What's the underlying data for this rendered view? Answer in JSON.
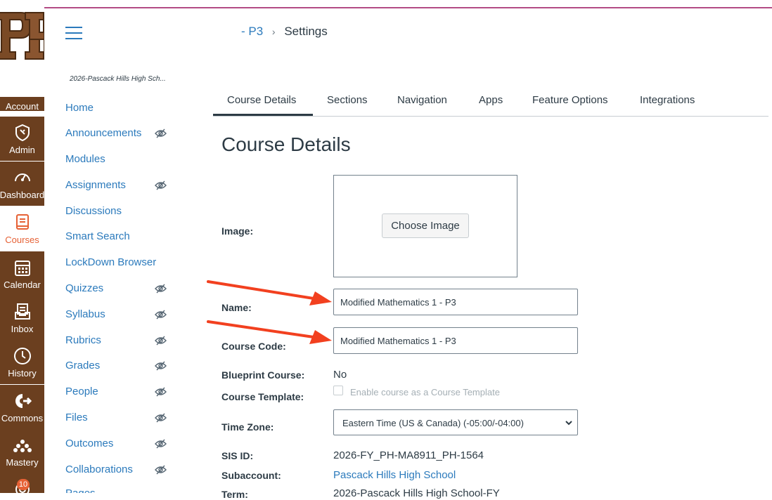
{
  "colors": {
    "nav_bg": "#6b3f1f",
    "accent": "#e66135",
    "link": "#2b7abc",
    "annotation_arrow": "#f2401f"
  },
  "global_nav": {
    "items": [
      {
        "label": "Account",
        "icon": "account-icon"
      },
      {
        "label": "Admin",
        "icon": "admin-shield-icon"
      },
      {
        "label": "Dashboard",
        "icon": "dashboard-gauge-icon"
      },
      {
        "label": "Courses",
        "icon": "courses-book-icon",
        "active": true
      },
      {
        "label": "Calendar",
        "icon": "calendar-icon"
      },
      {
        "label": "Inbox",
        "icon": "inbox-icon"
      },
      {
        "label": "History",
        "icon": "history-clock-icon"
      },
      {
        "label": "Commons",
        "icon": "commons-icon"
      },
      {
        "label": "Mastery",
        "icon": "mastery-dots-icon"
      },
      {
        "label": "",
        "icon": "help-icon",
        "badge": "10"
      }
    ]
  },
  "header": {
    "breadcrumb_course": "- P3",
    "breadcrumb_separator": "›",
    "breadcrumb_current": "Settings"
  },
  "course_nav": {
    "course_name": "2026-Pascack Hills High Sch...",
    "items": [
      {
        "label": "Home",
        "hidden": false
      },
      {
        "label": "Announcements",
        "hidden": true
      },
      {
        "label": "Modules",
        "hidden": false
      },
      {
        "label": "Assignments",
        "hidden": true
      },
      {
        "label": "Discussions",
        "hidden": false
      },
      {
        "label": "Smart Search",
        "hidden": false
      },
      {
        "label": "LockDown Browser",
        "hidden": false
      },
      {
        "label": "Quizzes",
        "hidden": true
      },
      {
        "label": "Syllabus",
        "hidden": true
      },
      {
        "label": "Rubrics",
        "hidden": true
      },
      {
        "label": "Grades",
        "hidden": true
      },
      {
        "label": "People",
        "hidden": true
      },
      {
        "label": "Files",
        "hidden": true
      },
      {
        "label": "Outcomes",
        "hidden": true
      },
      {
        "label": "Collaborations",
        "hidden": true
      },
      {
        "label": "Pages",
        "hidden": true
      }
    ]
  },
  "tabs": [
    {
      "label": "Course Details",
      "active": true
    },
    {
      "label": "Sections"
    },
    {
      "label": "Navigation"
    },
    {
      "label": "Apps"
    },
    {
      "label": "Feature Options"
    },
    {
      "label": "Integrations"
    }
  ],
  "form": {
    "title": "Course Details",
    "image_label": "Image:",
    "choose_image_label": "Choose Image",
    "name_label": "Name:",
    "name_value": "Modified Mathematics 1 - P3",
    "code_label": "Course Code:",
    "code_value": "Modified Mathematics 1 - P3",
    "blueprint_label": "Blueprint Course:",
    "blueprint_value": "No",
    "template_label": "Course Template:",
    "template_checkbox_label": "Enable course as a Course Template",
    "timezone_label": "Time Zone:",
    "timezone_value": "Eastern Time (US & Canada) (-05:00/-04:00)",
    "sis_label": "SIS ID:",
    "sis_value": "2026-FY_PH-MA8911_PH-1564",
    "subaccount_label": "Subaccount:",
    "subaccount_value": "Pascack Hills High School",
    "term_label": "Term:",
    "term_value": "2026-Pascack Hills High School-FY"
  }
}
